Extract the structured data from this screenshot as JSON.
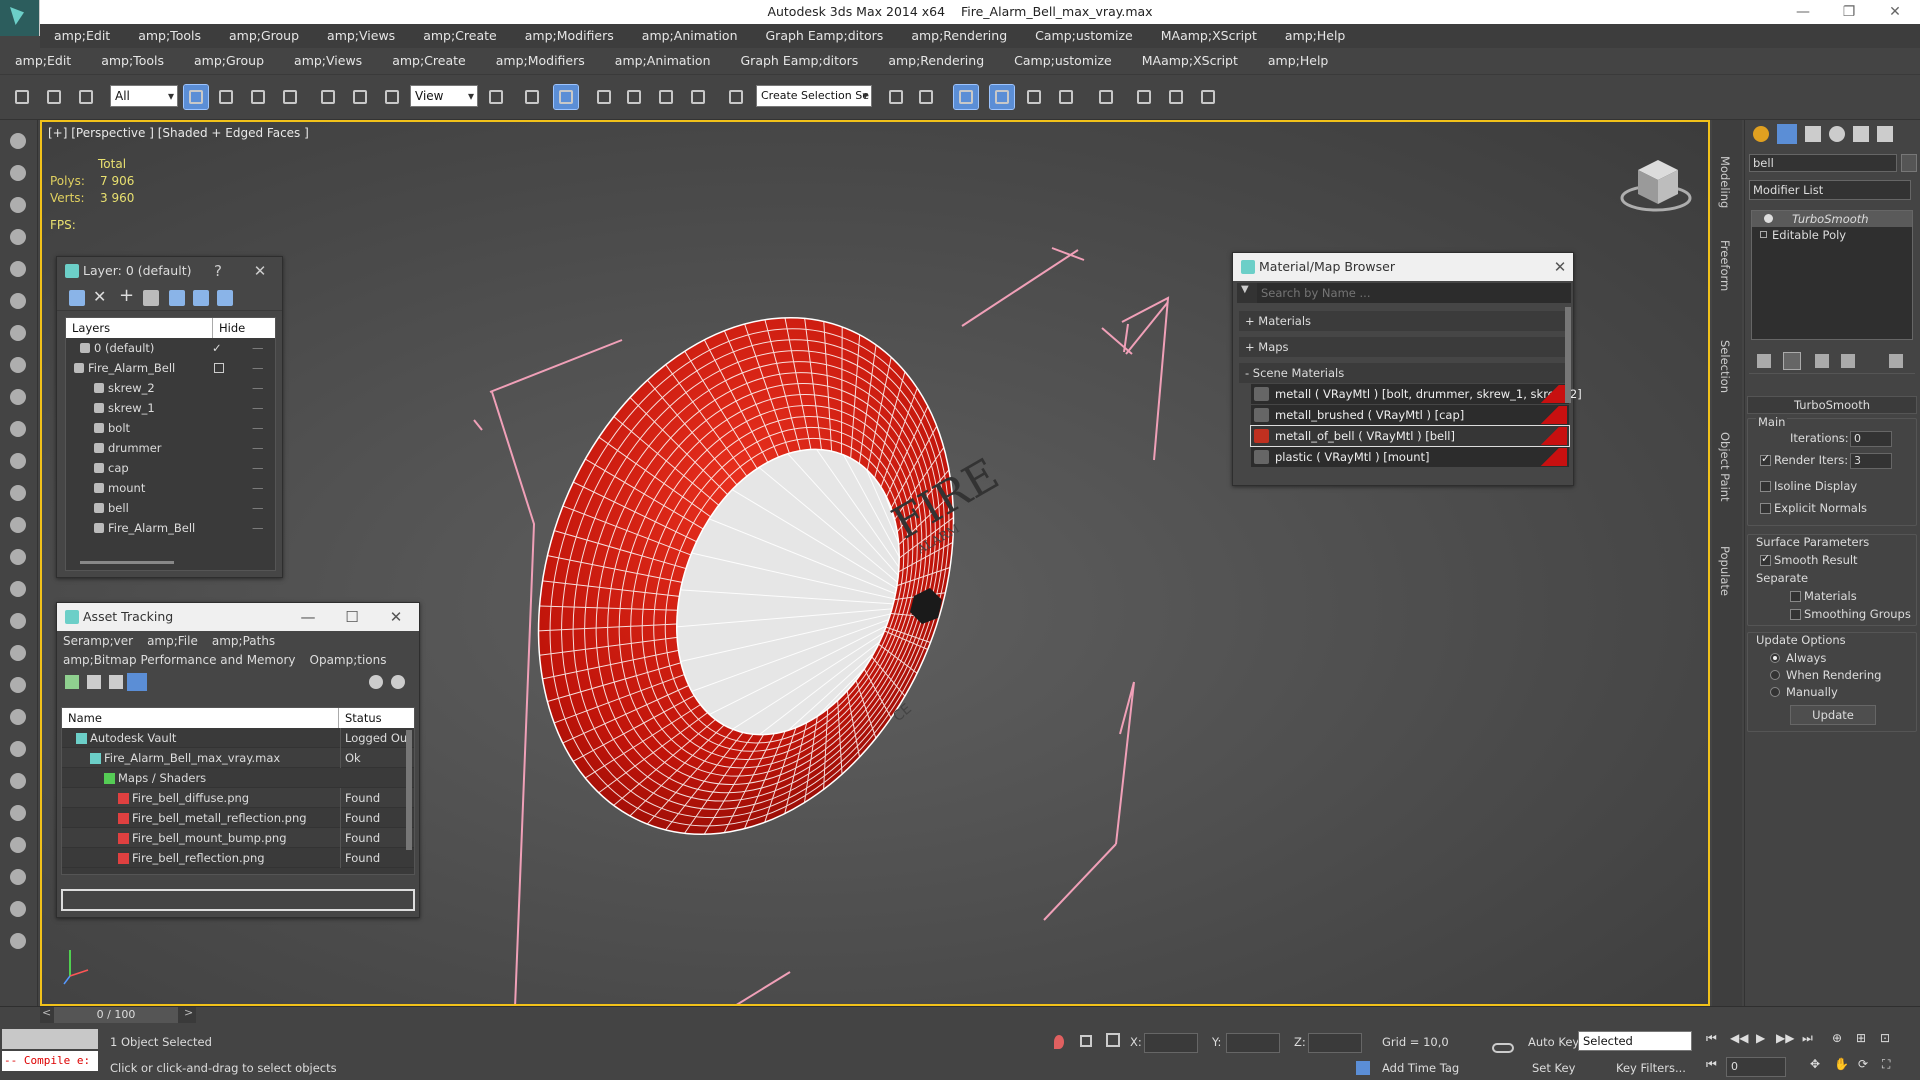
{
  "window": {
    "app_title": "Autodesk 3ds Max  2014 x64",
    "file_title": "Fire_Alarm_Bell_max_vray.max"
  },
  "menu_top": [
    "amp;Edit",
    "amp;Tools",
    "amp;Group",
    "amp;Views",
    "amp;Create",
    "amp;Modifiers",
    "amp;Animation",
    "Graph Eamp;ditors",
    "amp;Rendering",
    "Camp;ustomize",
    "MAamp;XScript",
    "amp;Help"
  ],
  "menu_main": [
    "amp;Edit",
    "amp;Tools",
    "amp;Group",
    "amp;Views",
    "amp;Create",
    "amp;Modifiers",
    "amp;Animation",
    "Graph Eamp;ditors",
    "amp;Rendering",
    "Camp;ustomize",
    "MAamp;XScript",
    "amp;Help"
  ],
  "toolbar": {
    "filter_select": "All",
    "ref_coord": "View",
    "selection_set": "Create Selection Se"
  },
  "viewport": {
    "label": "[+] [Perspective ] [Shaded + Edged Faces ]",
    "stats_total": "Total",
    "polys_label": "Polys:",
    "polys_value": "7 906",
    "verts_label": "Verts:",
    "verts_value": "3 960",
    "fps_label": "FPS:",
    "bell_text_1": "FIRE",
    "bell_text_2": "ALARM",
    "ce_mark": "CE",
    "colors": {
      "bell_red": "#d11a0e",
      "bell_face": "#e8e8e8",
      "wire": "#ffffff",
      "bbox": "#f0a0b8",
      "frame": "#f2c21a"
    }
  },
  "layer_panel": {
    "title": "Layer: 0 (default)",
    "help": "?",
    "col_layers": "Layers",
    "col_hide": "Hide",
    "items": [
      {
        "name": "0 (default)",
        "level": 1
      },
      {
        "name": "Fire_Alarm_Bell",
        "level": 0
      },
      {
        "name": "skrew_2",
        "level": 2
      },
      {
        "name": "skrew_1",
        "level": 2
      },
      {
        "name": "bolt",
        "level": 2
      },
      {
        "name": "drummer",
        "level": 2
      },
      {
        "name": "cap",
        "level": 2
      },
      {
        "name": "mount",
        "level": 2
      },
      {
        "name": "bell",
        "level": 2
      },
      {
        "name": "Fire_Alarm_Bell",
        "level": 2
      }
    ]
  },
  "asset_panel": {
    "title": "Asset Tracking",
    "menu": [
      "Seramp;ver",
      "amp;File",
      "amp;Paths"
    ],
    "menu2": [
      "amp;Bitmap Performance and Memory",
      "Opamp;tions"
    ],
    "col_name": "Name",
    "col_status": "Status",
    "rows": [
      {
        "name": "Autodesk Vault",
        "status": "Logged Ou",
        "indent": 1
      },
      {
        "name": "Fire_Alarm_Bell_max_vray.max",
        "status": "Ok",
        "indent": 2
      },
      {
        "name": "Maps / Shaders",
        "status": "",
        "indent": 3
      },
      {
        "name": "Fire_bell_diffuse.png",
        "status": "Found",
        "indent": 4
      },
      {
        "name": "Fire_bell_metall_reflection.png",
        "status": "Found",
        "indent": 4
      },
      {
        "name": "Fire_bell_mount_bump.png",
        "status": "Found",
        "indent": 4
      },
      {
        "name": "Fire_bell_reflection.png",
        "status": "Found",
        "indent": 4
      }
    ]
  },
  "material_panel": {
    "title": "Material/Map Browser",
    "search_placeholder": "Search by Name ...",
    "group_materials": "+ Materials",
    "group_maps": "+ Maps",
    "group_scene": "- Scene Materials",
    "items": [
      "metall  ( VRayMtl ) [bolt, drummer, skrew_1, skrew_2]",
      "metall_brushed  ( VRayMtl ) [cap]",
      "metall_of_bell  ( VRayMtl ) [bell]",
      "plastic  ( VRayMtl ) [mount]"
    ],
    "selected_index": 2
  },
  "command_panel": {
    "object_name": "bell",
    "modifier_list": "Modifier List",
    "stack": [
      "TurboSmooth",
      "Editable Poly"
    ],
    "rollout_title": "TurboSmooth",
    "main_label": "Main",
    "iterations_label": "Iterations:",
    "iterations_value": "0",
    "render_iters_label": "Render Iters:",
    "render_iters_value": "3",
    "isoline": "Isoline Display",
    "explicit_normals": "Explicit Normals",
    "surface_params": "Surface Parameters",
    "smooth_result": "Smooth Result",
    "separate": "Separate",
    "materials": "Materials",
    "smoothing_groups": "Smoothing Groups",
    "update_options": "Update Options",
    "always": "Always",
    "when_rendering": "When Rendering",
    "manually": "Manually",
    "update_btn": "Update"
  },
  "side_tabs": [
    "Modeling",
    "Freeform",
    "Selection",
    "Object Paint",
    "Populate"
  ],
  "bottom": {
    "time_slider": "0 / 100",
    "script_label": "-- Compile e:",
    "status_selected": "1 Object Selected",
    "prompt": "Click or click-and-drag to select objects",
    "x_label": "X:",
    "y_label": "Y:",
    "z_label": "Z:",
    "grid": "Grid = 10,0",
    "add_time_tag": "Add Time Tag",
    "auto_key": "Auto Key",
    "set_key": "Set Key",
    "key_mode": "Selected",
    "key_filters": "Key Filters...",
    "frame": "0"
  }
}
